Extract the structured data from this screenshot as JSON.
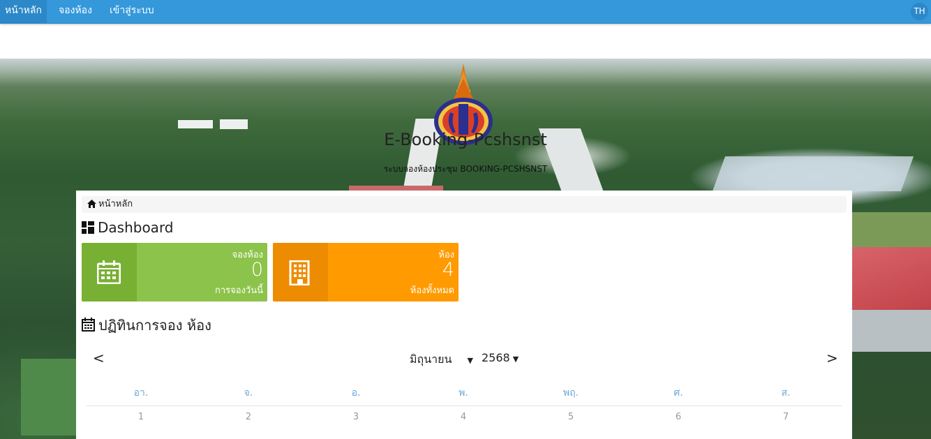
{
  "navbar": {
    "items": [
      {
        "label": "หน้าหลัก",
        "active": true
      },
      {
        "label": "จองห้อง",
        "active": false
      },
      {
        "label": "เข้าสู่ระบบ",
        "active": false
      }
    ],
    "language": "TH",
    "color": "#3498db"
  },
  "header": {
    "title": "E-Booking-Pcshsnst",
    "subtitle": "ระบบจองห้องประชุม BOOKING-PCSHSNST"
  },
  "breadcrumb": {
    "icon": "home-icon",
    "label": "หน้าหลัก"
  },
  "dashboard": {
    "title": "Dashboard",
    "icon": "dashboard-icon",
    "cards": [
      {
        "label": "จองห้อง",
        "value": "0",
        "sub": "การจองวันนี้",
        "icon": "calendar-icon",
        "color": "#8cc34a"
      },
      {
        "label": "ห้อง",
        "value": "4",
        "sub": "ห้องทั้งหมด",
        "icon": "building-icon",
        "color": "#ff9b00"
      }
    ]
  },
  "calendar": {
    "title": "ปฏิทินการจอง ห้อง",
    "icon": "calendar-icon",
    "prev": "<",
    "next": ">",
    "month": "มิถุนายน",
    "year": "2568",
    "weekdays": [
      "อา.",
      "จ.",
      "อ.",
      "พ.",
      "พฤ.",
      "ศ.",
      "ส."
    ],
    "days": [
      "1",
      "2",
      "3",
      "4",
      "5",
      "6",
      "7"
    ]
  }
}
